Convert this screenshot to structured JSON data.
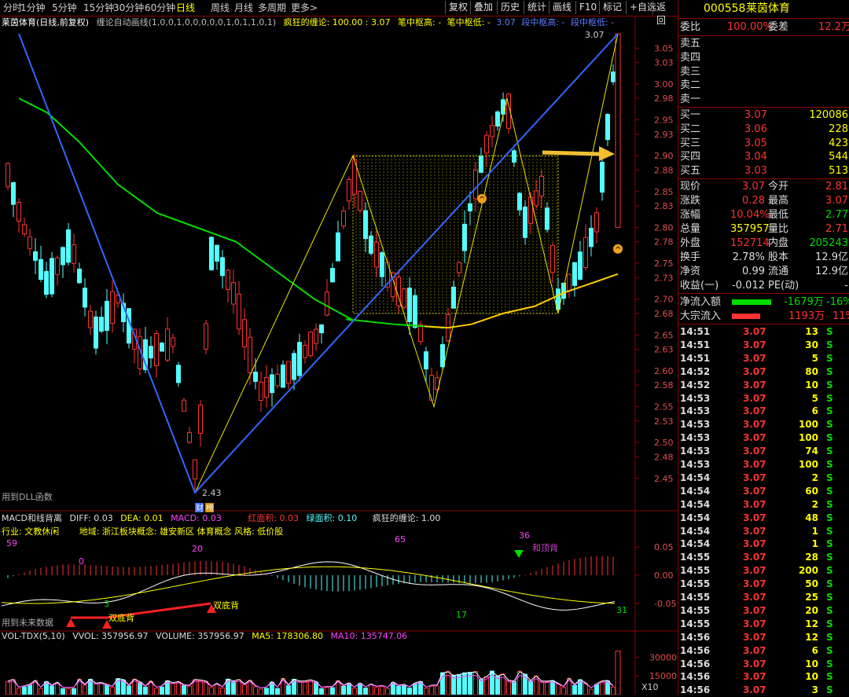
{
  "toolbar": {
    "periods": [
      "分时",
      "1分钟",
      "5分钟",
      "15分钟",
      "30分钟",
      "60分钟",
      "日线",
      "周线",
      "月线",
      "多周期",
      "更多>"
    ],
    "active_period": "日线",
    "right_buttons": [
      "复权",
      "叠加",
      "历史",
      "统计",
      "画线",
      "F10",
      "标记",
      "+自选",
      "返回"
    ]
  },
  "main_title": {
    "stock": "莱茵体育(日线,前复权)",
    "indicator": "缠论自动画线(1,0,0,1,0,0,0,0,0,1,0,1,1,0,1)",
    "crazy": "疯狂的缠论: 100.00 : 3.07",
    "bi_high": "笔中枢高: -",
    "bi_low": "笔中枢低: -",
    "bi_low_val": "3.07",
    "seg_high": "段中枢高: -",
    "seg_low": "段中枢低: -"
  },
  "main_chart": {
    "price_axis": [
      "3.05",
      "3.03",
      "3.00",
      "2.98",
      "2.95",
      "2.93",
      "2.90",
      "2.88",
      "2.85",
      "2.83",
      "2.80",
      "2.78",
      "2.75",
      "2.73",
      "2.70",
      "2.68",
      "2.65",
      "2.63",
      "2.60",
      "2.58",
      "2.55",
      "2.53",
      "2.50",
      "2.48",
      "2.45"
    ],
    "high_label": "3.07",
    "low_label": "2.43",
    "badge_cai": "财",
    "badge_bang": "榜",
    "dll_note": "用到DLL函数"
  },
  "macd": {
    "title": "MACD和线背离",
    "diff": "DIFF: 0.03",
    "dea": "DEA: 0.01",
    "macd": "MACD: 0.03",
    "red_area": "红面积: 0.03",
    "green_area": "绿面积: 0.10",
    "crazy": "疯狂的缠论: 1.00",
    "industry": "行业: 文教休闲",
    "region": "地域: 浙江板块概念: 雄安新区 体育概念 风格: 低价股",
    "axis": [
      "0.05",
      "0.00",
      "-0.05"
    ],
    "counts": [
      "59",
      "0",
      "20",
      "65",
      "36",
      "3",
      "17",
      "31"
    ],
    "labels": {
      "double_bottom1": "双底背",
      "double_bottom2": "双底背",
      "top_div": "和顶背",
      "future": "用到未来数据"
    }
  },
  "volume": {
    "title": "VOL-TDX(5,10)",
    "vvol": "VVOL: 357956.97",
    "volume": "VOLUME: 357956.97",
    "ma5": "MA5: 178306.80",
    "ma10": "MA10: 135747.06",
    "axis": [
      "30000",
      "15000"
    ],
    "unit": "X10"
  },
  "quote": {
    "code": "000558",
    "name": "莱茵体育",
    "weibi_label": "委比",
    "weibi": "100.00%",
    "weicha_label": "委差",
    "weicha": "12.2万",
    "asks": [
      {
        "label": "卖五"
      },
      {
        "label": "卖四"
      },
      {
        "label": "卖三"
      },
      {
        "label": "卖二"
      },
      {
        "label": "卖一"
      }
    ],
    "bids": [
      {
        "label": "买一",
        "price": "3.07",
        "vol": "120086"
      },
      {
        "label": "买二",
        "price": "3.06",
        "vol": "228"
      },
      {
        "label": "买三",
        "price": "3.05",
        "vol": "423"
      },
      {
        "label": "买四",
        "price": "3.04",
        "vol": "544"
      },
      {
        "label": "买五",
        "price": "3.03",
        "vol": "513"
      }
    ],
    "stats": [
      {
        "l1": "现价",
        "v1": "3.07",
        "l2": "今开",
        "v2": "2.81"
      },
      {
        "l1": "涨跌",
        "v1": "0.28",
        "l2": "最高",
        "v2": "3.07"
      },
      {
        "l1": "涨幅",
        "v1": "10.04%",
        "l2": "最低",
        "v2": "2.77"
      },
      {
        "l1": "总量",
        "v1": "357957",
        "l2": "量比",
        "v2": "2.71"
      },
      {
        "l1": "外盘",
        "v1": "152714",
        "l2": "内盘",
        "v2": "205243"
      },
      {
        "l1": "换手",
        "v1": "2.78%",
        "l2": "股本",
        "v2": "12.9亿"
      },
      {
        "l1": "净资",
        "v1": "0.99",
        "l2": "流通",
        "v2": "12.9亿"
      },
      {
        "l1": "收益(一)",
        "v1": "-0.012",
        "l2": "PE(动)",
        "v2": "-"
      }
    ],
    "netflow_label": "净流入额",
    "netflow": "-1679万",
    "netflow_pct": "-16%",
    "block_label": "大宗流入",
    "block": "1193万",
    "block_pct": "11%",
    "ticks": [
      {
        "t": "14:51",
        "p": "3.07",
        "v": "13",
        "s": "S"
      },
      {
        "t": "14:51",
        "p": "3.07",
        "v": "30",
        "s": "S"
      },
      {
        "t": "14:51",
        "p": "3.07",
        "v": "5",
        "s": "S"
      },
      {
        "t": "14:52",
        "p": "3.07",
        "v": "80",
        "s": "S"
      },
      {
        "t": "14:52",
        "p": "3.07",
        "v": "10",
        "s": "S"
      },
      {
        "t": "14:53",
        "p": "3.07",
        "v": "5",
        "s": "S"
      },
      {
        "t": "14:53",
        "p": "3.07",
        "v": "6",
        "s": "S"
      },
      {
        "t": "14:53",
        "p": "3.07",
        "v": "100",
        "s": "S"
      },
      {
        "t": "14:53",
        "p": "3.07",
        "v": "100",
        "s": "S"
      },
      {
        "t": "14:53",
        "p": "3.07",
        "v": "74",
        "s": "S"
      },
      {
        "t": "14:53",
        "p": "3.07",
        "v": "100",
        "s": "S"
      },
      {
        "t": "14:54",
        "p": "3.07",
        "v": "2",
        "s": "S"
      },
      {
        "t": "14:54",
        "p": "3.07",
        "v": "60",
        "s": "S"
      },
      {
        "t": "14:54",
        "p": "3.07",
        "v": "2",
        "s": "S"
      },
      {
        "t": "14:54",
        "p": "3.07",
        "v": "48",
        "s": "S"
      },
      {
        "t": "14:54",
        "p": "3.07",
        "v": "1",
        "s": "S"
      },
      {
        "t": "14:54",
        "p": "3.07",
        "v": "1",
        "s": "S"
      },
      {
        "t": "14:55",
        "p": "3.07",
        "v": "28",
        "s": "S"
      },
      {
        "t": "14:55",
        "p": "3.07",
        "v": "200",
        "s": "S"
      },
      {
        "t": "14:55",
        "p": "3.07",
        "v": "50",
        "s": "S"
      },
      {
        "t": "14:55",
        "p": "3.07",
        "v": "25",
        "s": "S"
      },
      {
        "t": "14:55",
        "p": "3.07",
        "v": "20",
        "s": "S"
      },
      {
        "t": "14:55",
        "p": "3.07",
        "v": "12",
        "s": "S"
      },
      {
        "t": "14:56",
        "p": "3.07",
        "v": "12",
        "s": "S"
      },
      {
        "t": "14:56",
        "p": "3.07",
        "v": "6",
        "s": "S"
      },
      {
        "t": "14:56",
        "p": "3.07",
        "v": "10",
        "s": "S"
      },
      {
        "t": "14:56",
        "p": "3.07",
        "v": "10",
        "s": "S"
      },
      {
        "t": "14:56",
        "p": "3.07",
        "v": "3",
        "s": "S"
      }
    ]
  },
  "colors": {
    "up": "#ff3232",
    "down": "#54ffff",
    "ma": "#ffcc00",
    "green": "#00dd00",
    "blue": "#3366ff",
    "yellow": "#ffff00",
    "frame": "#8b0000"
  }
}
